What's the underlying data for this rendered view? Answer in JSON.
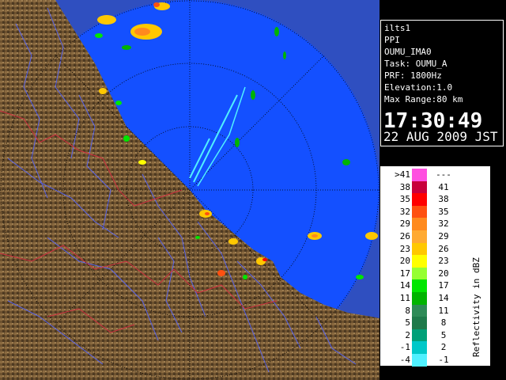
{
  "info": {
    "line1": "ilts1",
    "line2": "PPI",
    "line3": "OUMU_IMA0",
    "line4": "Task: OUMU_A",
    "line5": "PRF: 1800Hz",
    "line6": "Elevation:1.0",
    "line7": "Max Range:80 km",
    "time": "17:30:49",
    "date": "22 AUG 2009 JST"
  },
  "legend": {
    "title": "Reflectivity in dBZ",
    "rows": [
      {
        "lo": ">41",
        "hi": "---",
        "color": "#ff4fe0"
      },
      {
        "lo": "38",
        "hi": "41",
        "color": "#c8003c"
      },
      {
        "lo": "35",
        "hi": "38",
        "color": "#ff0000"
      },
      {
        "lo": "32",
        "hi": "35",
        "color": "#ff5010"
      },
      {
        "lo": "29",
        "hi": "32",
        "color": "#ff8a1e"
      },
      {
        "lo": "26",
        "hi": "29",
        "color": "#ffaa32"
      },
      {
        "lo": "23",
        "hi": "26",
        "color": "#ffc800"
      },
      {
        "lo": "20",
        "hi": "23",
        "color": "#ffff00"
      },
      {
        "lo": "17",
        "hi": "20",
        "color": "#96ff32"
      },
      {
        "lo": "14",
        "hi": "17",
        "color": "#00e600"
      },
      {
        "lo": "11",
        "hi": "14",
        "color": "#00b400"
      },
      {
        "lo": "8",
        "hi": "11",
        "color": "#2e8b57"
      },
      {
        "lo": "5",
        "hi": "8",
        "color": "#1e7a4a"
      },
      {
        "lo": "2",
        "hi": "5",
        "color": "#00a078"
      },
      {
        "lo": "-1",
        "hi": "2",
        "color": "#00c8c8"
      },
      {
        "lo": "-4",
        "hi": "-1",
        "color": "#50f0ff"
      }
    ]
  },
  "colors": {
    "land": "#6b4f2c",
    "sea_in_range": "#1a5cff",
    "sea_out_range": "#2f5ad8",
    "river": "#5a6cff",
    "prefecture_border": "#c0303a"
  }
}
